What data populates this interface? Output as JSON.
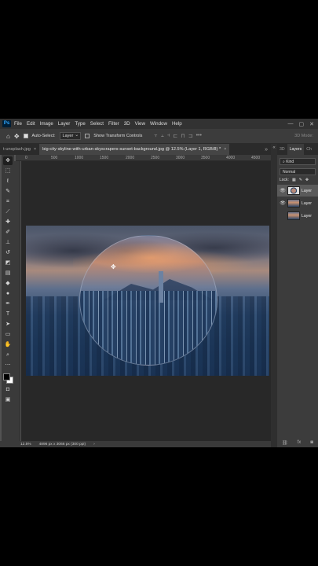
{
  "menubar": {
    "logo": "Ps",
    "items": [
      "File",
      "Edit",
      "Image",
      "Layer",
      "Type",
      "Select",
      "Filter",
      "3D",
      "View",
      "Window",
      "Help"
    ],
    "window_controls": [
      "—",
      "▢",
      "✕"
    ]
  },
  "options": {
    "auto_select_label": "Auto-Select:",
    "auto_select_value": "Layer",
    "transform_label": "Show Transform Controls",
    "more": "•••",
    "mode_3d": "3D Mode:"
  },
  "tabs": [
    {
      "label": "t-unsplash.jpg"
    },
    {
      "label": "big-city-skyline-with-urban-skyscrapers-sunset-background.jpg @ 12.5% (Layer 1, RGB/8) *"
    }
  ],
  "tab_overflow": "»",
  "ruler": {
    "top_ticks": [
      "0",
      "500",
      "1000",
      "1500",
      "2000",
      "2500",
      "3000",
      "3500",
      "4000",
      "4500"
    ]
  },
  "status": {
    "zoom": "12.5%",
    "doc_info": "4896 px x 3066 px (300 ppi)",
    "arrow": "›"
  },
  "panel": {
    "tabs": [
      "3D",
      "Layers",
      "Ch"
    ],
    "filter": "Kind",
    "blend": "Normal",
    "lock_label": "Lock:",
    "layers": [
      {
        "name": "Layer"
      },
      {
        "name": "Layer"
      },
      {
        "name": "Layer"
      }
    ],
    "footer_icons": [
      "link-icon",
      "fx-icon",
      "mask-icon"
    ]
  },
  "colors": {
    "foreground": "#000000",
    "background": "#ffffff",
    "accent": "#31a8ff"
  }
}
